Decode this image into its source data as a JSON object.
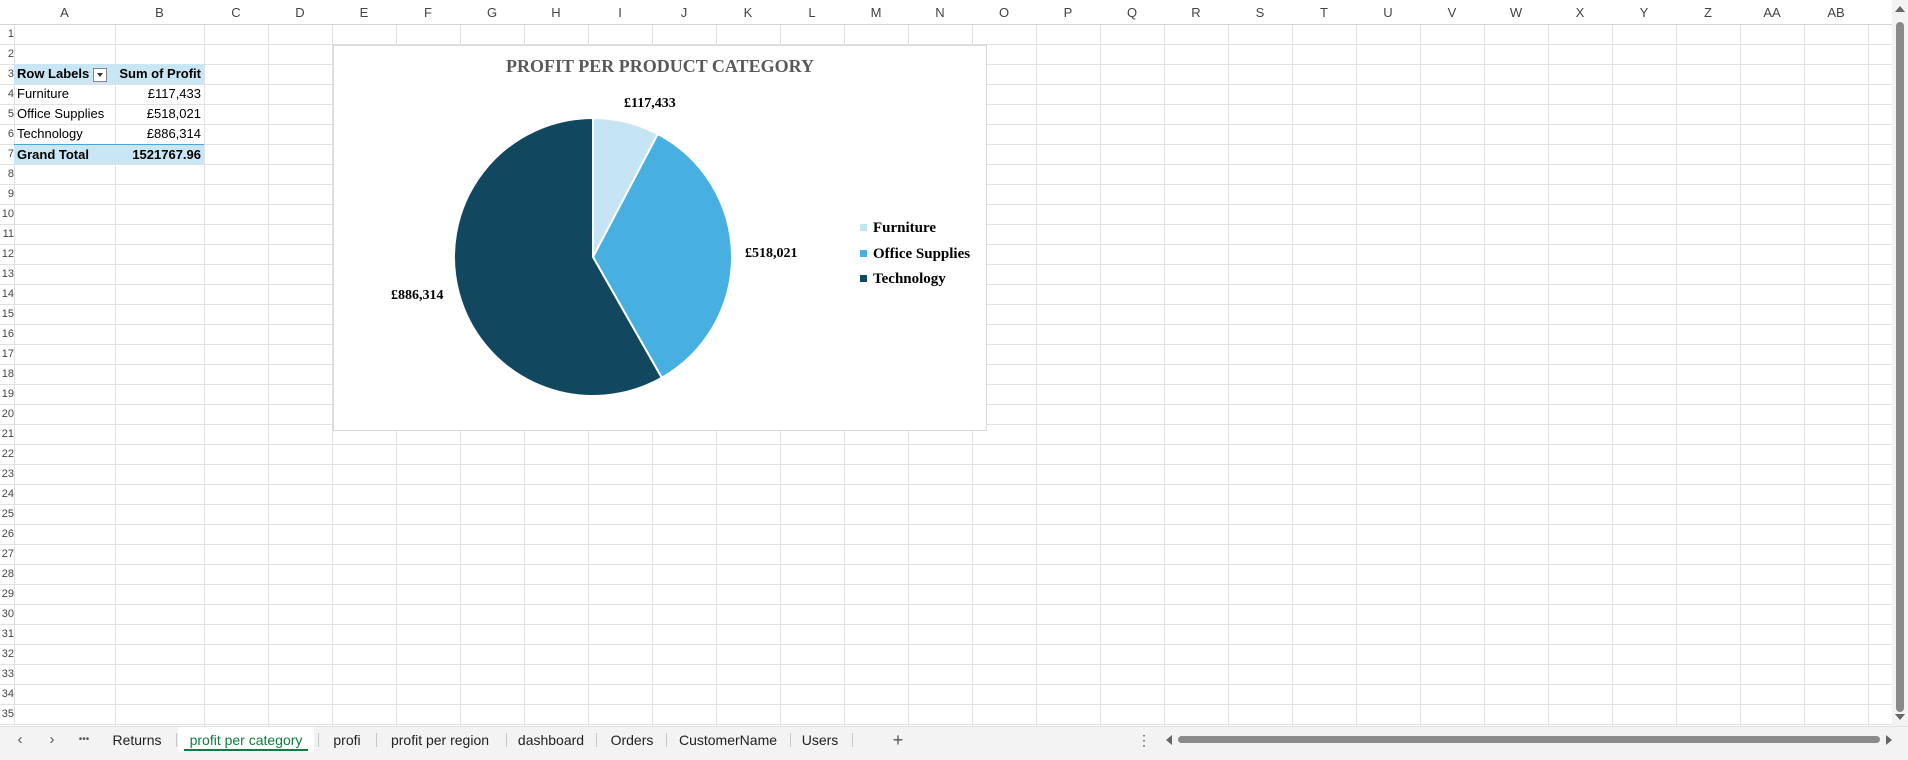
{
  "columns": [
    "A",
    "B",
    "C",
    "D",
    "E",
    "F",
    "G",
    "H",
    "I",
    "J",
    "K",
    "L",
    "M",
    "N",
    "O",
    "P",
    "Q",
    "R",
    "S",
    "T",
    "U",
    "V",
    "W",
    "X",
    "Y",
    "Z",
    "AA",
    "AB"
  ],
  "rows": [
    "1",
    "2",
    "3",
    "4",
    "5",
    "6",
    "7",
    "8",
    "9",
    "10",
    "11",
    "12",
    "13",
    "14",
    "15",
    "16",
    "17",
    "18",
    "19",
    "20",
    "21",
    "22",
    "23",
    "24",
    "25",
    "26",
    "27",
    "28",
    "29",
    "30",
    "31",
    "32",
    "33",
    "34",
    "35"
  ],
  "pivot": {
    "header_row_label": "Row Labels",
    "header_value_label": "Sum of Profit",
    "rows": [
      {
        "label": "Furniture",
        "value": "£117,433"
      },
      {
        "label": "Office Supplies",
        "value": "£518,021"
      },
      {
        "label": "Technology",
        "value": "£886,314"
      }
    ],
    "total_label": "Grand Total",
    "total_value": "1521767.96"
  },
  "chart_data": {
    "type": "pie",
    "title": "PROFIT PER PRODUCT CATEGORY",
    "categories": [
      "Furniture",
      "Office Supplies",
      "Technology"
    ],
    "values": [
      117433,
      518021,
      886314
    ],
    "data_labels": [
      "£117,433",
      "£518,021",
      "£886,314"
    ],
    "colors": [
      "#c5e5f5",
      "#47b0e0",
      "#11475f"
    ],
    "legend_position": "right"
  },
  "tabs": {
    "items": [
      "Returns",
      "profit per category",
      "profi",
      "profit per region",
      "dashboard",
      "Orders",
      "CustomerName",
      "Users"
    ],
    "active_index": 1,
    "add_label": "+",
    "more_label": "•••",
    "options_label": "⋮"
  }
}
